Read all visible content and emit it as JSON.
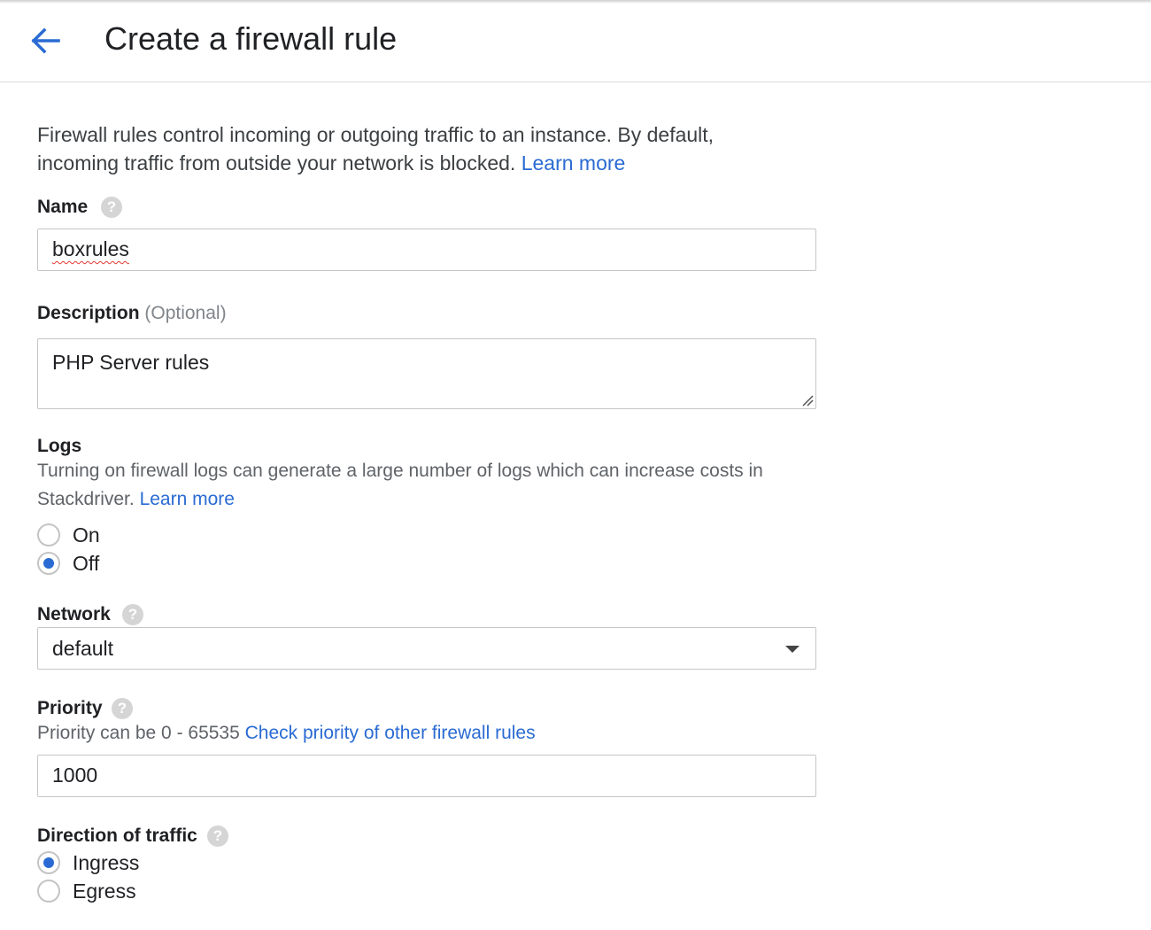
{
  "header": {
    "title": "Create a firewall rule",
    "back_icon": "arrow-back-icon"
  },
  "colors": {
    "accent": "#2a6bd3",
    "link": "#2a6bd3"
  },
  "intro": {
    "text": "Firewall rules control incoming or outgoing traffic to an instance. By default, incoming traffic from outside your network is blocked.",
    "link": "Learn more"
  },
  "name": {
    "label": "Name",
    "value": "boxrules"
  },
  "description": {
    "label": "Description",
    "optional": "(Optional)",
    "value": "PHP Server rules"
  },
  "logs": {
    "label": "Logs",
    "help": "Turning on firewall logs can generate a large number of logs which can increase costs in Stackdriver.",
    "link": "Learn more",
    "options": [
      "On",
      "Off"
    ],
    "selected": "Off"
  },
  "network": {
    "label": "Network",
    "value": "default"
  },
  "priority": {
    "label": "Priority",
    "help": "Priority can be 0 - 65535",
    "link": "Check priority of other firewall rules",
    "value": "1000"
  },
  "direction": {
    "label": "Direction of traffic",
    "options": [
      "Ingress",
      "Egress"
    ],
    "selected": "Ingress"
  }
}
